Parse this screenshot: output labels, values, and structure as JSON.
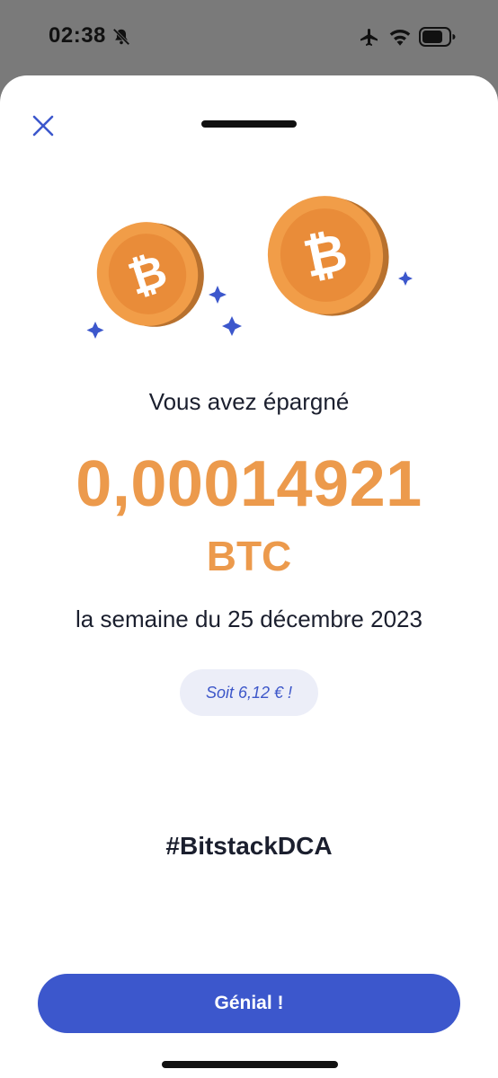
{
  "status_bar": {
    "time": "02:38",
    "icons": [
      "bell-slash-icon",
      "airplane-icon",
      "wifi-icon",
      "battery-icon"
    ]
  },
  "sheet": {
    "close_icon": "close-icon",
    "saved_label": "Vous avez épargné",
    "amount": "0,00014921",
    "currency": "BTC",
    "period": "la semaine du 25 décembre 2023",
    "eur_equivalent": "Soit 6,12 € !",
    "hashtag": "#BitstackDCA",
    "cta_label": "Génial !"
  },
  "colors": {
    "accent_blue": "#3c57cc",
    "bitcoin_orange": "#ec9a4c",
    "pill_background": "#eceef8",
    "text_dark": "#1b1f2e"
  }
}
